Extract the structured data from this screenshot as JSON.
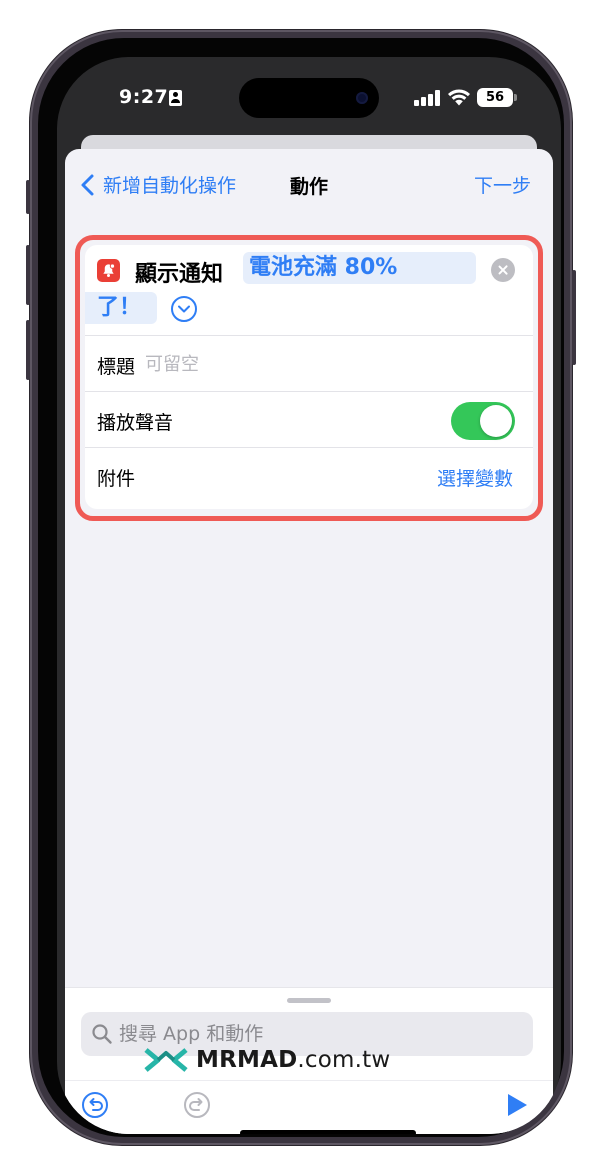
{
  "status_bar": {
    "time": "9:27",
    "battery": "56"
  },
  "nav": {
    "back_label": "新增自動化操作",
    "title": "動作",
    "next_label": "下一步"
  },
  "action": {
    "name": "顯示通知",
    "message_line1": "電池充滿 80%",
    "message_line2": "了！",
    "icon": "notification-bell-icon",
    "icon_color": "#ea3f36"
  },
  "fields": {
    "title_label": "標題",
    "title_placeholder": "可留空",
    "sound_label": "播放聲音",
    "sound_on": true,
    "attachment_label": "附件",
    "attachment_value": "選擇變數"
  },
  "bottom": {
    "search_placeholder": "搜尋 App 和動作"
  },
  "watermark": {
    "brand": "MRMAD",
    "suffix": ".com.tw"
  },
  "colors": {
    "accent": "#2f7ef5",
    "toggle_on": "#34c759",
    "highlight": "#ef5a55"
  }
}
